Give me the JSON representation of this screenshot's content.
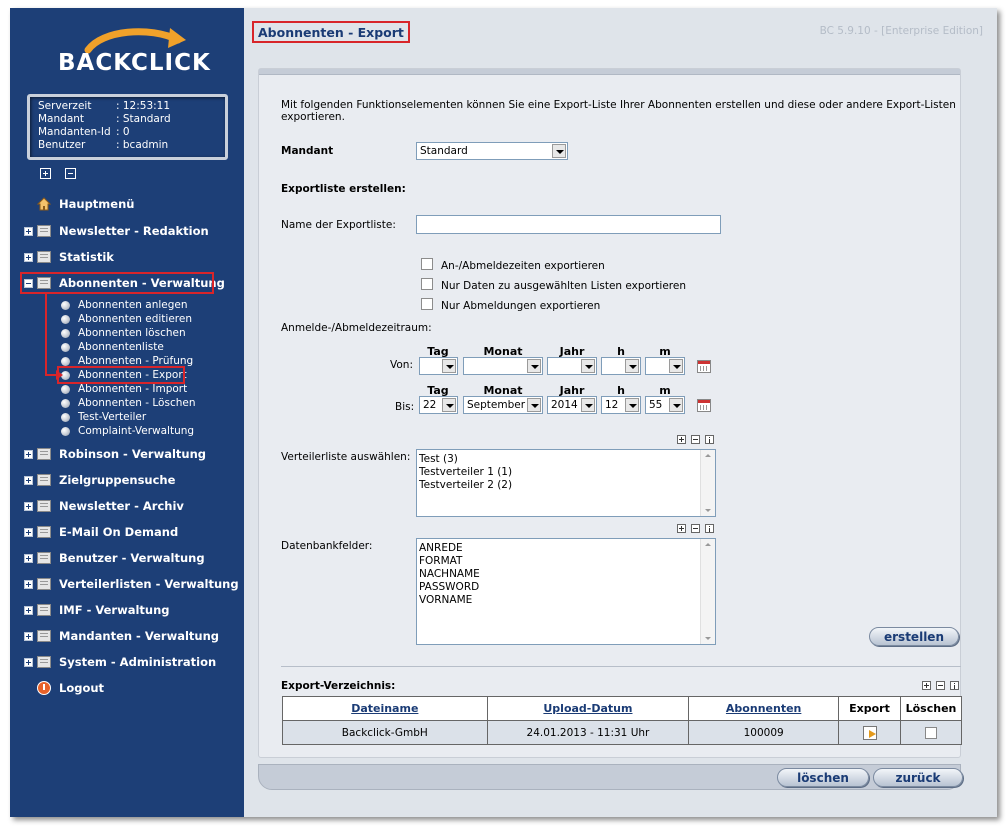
{
  "sidebar": {
    "logo": "BACKCLICK",
    "info": {
      "server_time_label": "Serverzeit",
      "server_time": ": 12:53:11",
      "client_label": "Mandant",
      "client": ": Standard",
      "client_id_label": "Mandanten-Id",
      "client_id": ": 0",
      "user_label": "Benutzer",
      "user": ": bcadmin"
    },
    "items": [
      {
        "label": "Hauptmenü"
      },
      {
        "label": "Newsletter - Redaktion"
      },
      {
        "label": "Statistik"
      },
      {
        "label": "Abonnenten - Verwaltung"
      },
      {
        "label": "Robinson - Verwaltung"
      },
      {
        "label": "Zielgruppensuche"
      },
      {
        "label": "Newsletter - Archiv"
      },
      {
        "label": "E-Mail On Demand"
      },
      {
        "label": "Benutzer - Verwaltung"
      },
      {
        "label": "Verteilerlisten - Verwaltung"
      },
      {
        "label": "IMF - Verwaltung"
      },
      {
        "label": "Mandanten - Verwaltung"
      },
      {
        "label": "System - Administration"
      },
      {
        "label": "Logout"
      }
    ],
    "subitems": [
      {
        "label": "Abonnenten anlegen"
      },
      {
        "label": "Abonnenten editieren"
      },
      {
        "label": "Abonnenten löschen"
      },
      {
        "label": "Abonnentenliste"
      },
      {
        "label": "Abonnenten - Prüfung"
      },
      {
        "label": "Abonnenten - Export"
      },
      {
        "label": "Abonnenten - Import"
      },
      {
        "label": "Abonnenten - Löschen"
      },
      {
        "label": "Test-Verteiler"
      },
      {
        "label": "Complaint-Verwaltung"
      }
    ]
  },
  "header": {
    "title": "Abonnenten - Export",
    "version": "BC 5.9.10 - [Enterprise Edition]"
  },
  "main": {
    "intro": "Mit folgenden Funktionselementen können Sie eine Export-Liste Ihrer Abonnenten erstellen und diese oder andere Export-Listen exportieren.",
    "mandant_label": "Mandant",
    "mandant_value": "Standard",
    "create_heading": "Exportliste erstellen:",
    "name_label": "Name der Exportliste:",
    "name_value": "",
    "checkboxes": [
      {
        "label": "An-/Abmeldezeiten exportieren"
      },
      {
        "label": "Nur Daten zu ausgewählten Listen exportieren"
      },
      {
        "label": "Nur Abmeldungen exportieren"
      }
    ],
    "period_label": "Anmelde-/Abmeldezeitraum:",
    "col_headers": {
      "day": "Tag",
      "month": "Monat",
      "year": "Jahr",
      "hour": "h",
      "minute": "m"
    },
    "from_label": "Von:",
    "to_label": "Bis:",
    "from": {
      "day": "",
      "month": "",
      "year": "",
      "hour": "",
      "minute": ""
    },
    "to": {
      "day": "22",
      "month": "September",
      "year": "2014",
      "hour": "12",
      "minute": "55"
    },
    "distribution_label": "Verteilerliste auswählen:",
    "distribution_items": [
      "Test (3)",
      "Testverteiler 1 (1)",
      "Testverteiler 2 (2)"
    ],
    "db_fields_label": "Datenbankfelder:",
    "db_fields": [
      "ANREDE",
      "FORMAT",
      "NACHNAME",
      "PASSWORD",
      "VORNAME"
    ],
    "create_button": "erstellen",
    "export_dir_heading": "Export-Verzeichnis:",
    "table": {
      "headers": [
        "Dateiname",
        "Upload-Datum",
        "Abonnenten",
        "Export",
        "Löschen"
      ],
      "rows": [
        {
          "filename": "Backclick-GmbH",
          "upload_date": "24.01.2013 - 11:31 Uhr",
          "subscribers": "100009"
        }
      ]
    },
    "delete_button": "löschen",
    "back_button": "zurück"
  },
  "colors": {
    "sidebar_bg": "#1d3f77",
    "highlight": "#d8252a",
    "content_bg": "#e9ecf1"
  }
}
